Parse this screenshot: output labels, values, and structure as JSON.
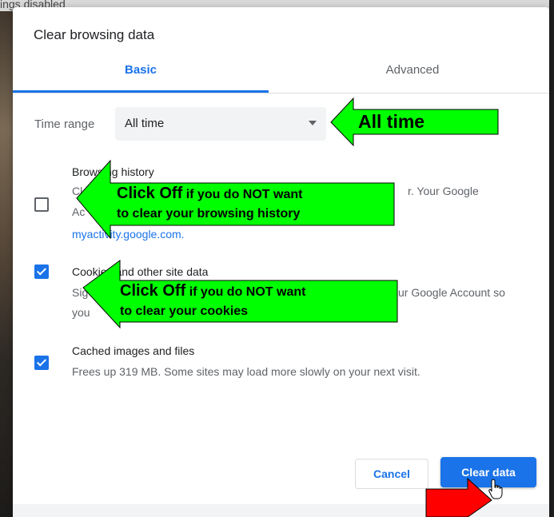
{
  "background": {
    "top_text": "ings disabled"
  },
  "dialog": {
    "title": "Clear browsing data",
    "tabs": [
      {
        "label": "Basic",
        "active": true
      },
      {
        "label": "Advanced",
        "active": false
      }
    ],
    "time_range": {
      "label": "Time range",
      "value": "All time",
      "icon": "dropdown-arrow-icon"
    },
    "items": [
      {
        "title": "Browsing history",
        "checked": false,
        "desc_line1": "Cle",
        "desc_line1_tail": "r. Your Google",
        "desc_line2": "Ac",
        "link": "myactivity.google.com."
      },
      {
        "title": "Cookies and other site data",
        "checked": true,
        "desc_line1": "Sig",
        "desc_line1_tail": "ur Google Account so",
        "desc_line2": "you"
      },
      {
        "title": "Cached images and files",
        "checked": true,
        "desc_line1": "Frees up 319 MB. Some sites may load more slowly on your next visit."
      }
    ],
    "buttons": {
      "cancel": "Cancel",
      "clear": "Clear data"
    }
  },
  "annotations": {
    "time_arrow": {
      "text": "All time",
      "color": "#00ff00"
    },
    "history_arrow": {
      "line1_big": "Click Off",
      "line1_small": " if you do NOT want",
      "line2": "to clear your browsing history",
      "color": "#00ff00"
    },
    "cookies_arrow": {
      "line1_big": "Click Off",
      "line1_small": " if you do NOT want",
      "line2": "to clear your cookies",
      "color": "#00ff00"
    },
    "clear_arrow": {
      "color": "#ff0000"
    }
  }
}
